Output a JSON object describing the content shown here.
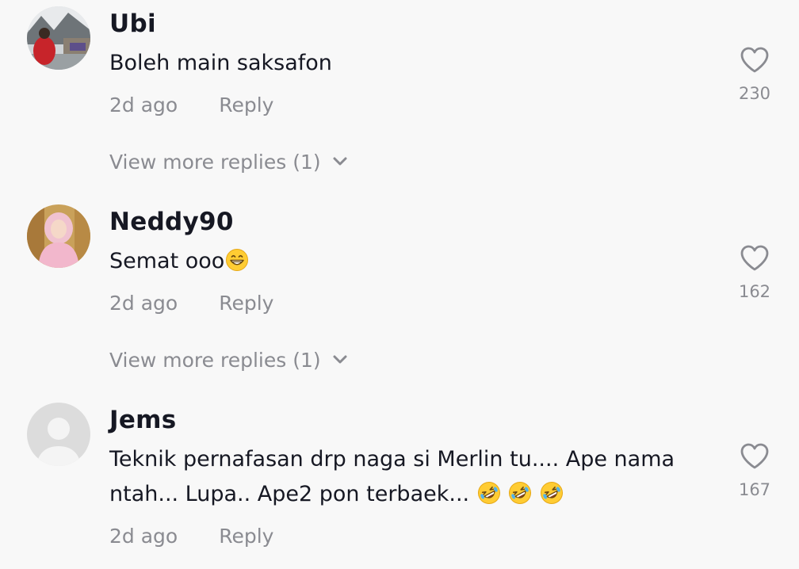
{
  "comments": [
    {
      "username": "Ubi",
      "text": "Boleh main saksafon",
      "time": "2d ago",
      "reply_label": "Reply",
      "likes": "230",
      "view_more": "View more replies (1)"
    },
    {
      "username": "Neddy90",
      "text": "Semat ooo",
      "time": "2d ago",
      "reply_label": "Reply",
      "likes": "162",
      "view_more": "View more replies (1)"
    },
    {
      "username": "Jems",
      "text_line1": "Teknik pernafasan drp naga si Merlin tu.... Ape nama",
      "text_line2": "ntah... Lupa.. Ape2 pon terbaek...",
      "time": "2d ago",
      "reply_label": "Reply",
      "likes": "167"
    }
  ],
  "icons": {
    "like": "heart-outline-icon",
    "expand": "chevron-down-icon",
    "emoji_grin": "grinning-face-icon",
    "emoji_laugh": "rolling-on-floor-laughing-icon"
  },
  "colors": {
    "background": "#f8f8f8",
    "primary_text": "#161823",
    "secondary_text": "#8a8b91"
  }
}
